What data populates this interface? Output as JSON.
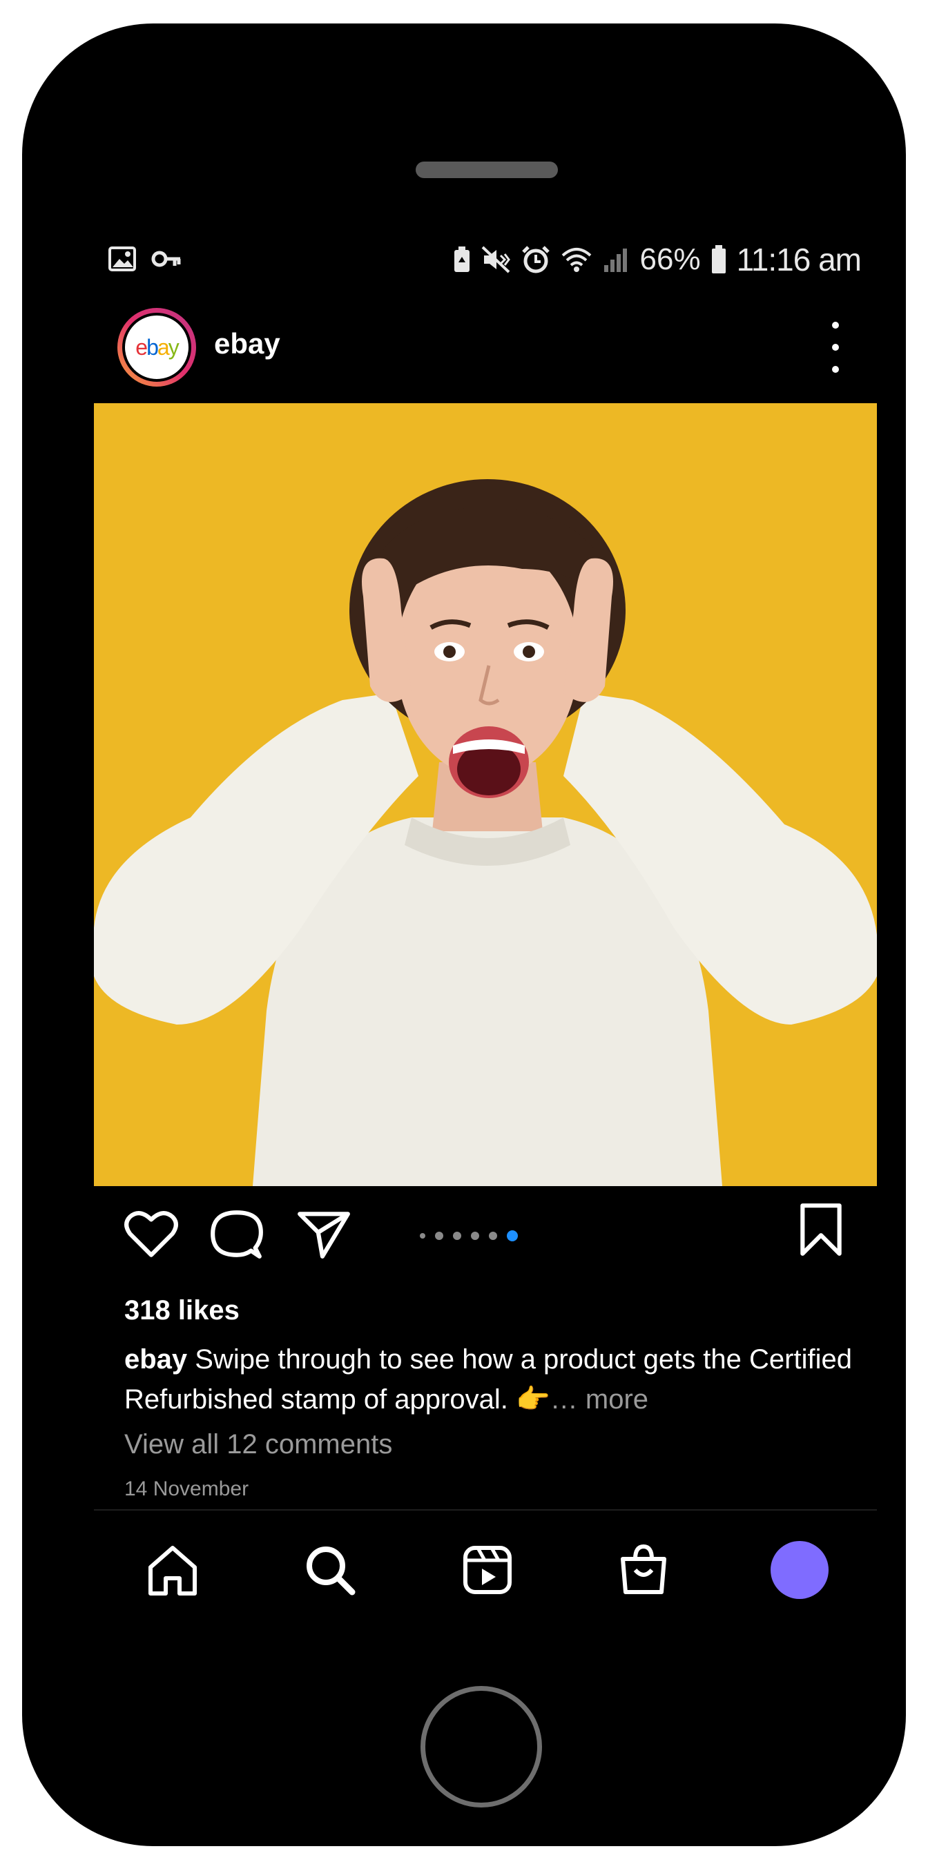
{
  "status_bar": {
    "left_icons": [
      "image-icon",
      "key-icon"
    ],
    "right_icons": [
      "battery-saver-icon",
      "mute-icon",
      "alarm-icon",
      "wifi-icon",
      "signal-icon"
    ],
    "battery": "66%",
    "time": "11:16 am"
  },
  "post": {
    "username": "ebay",
    "avatar_logo": {
      "e": "e",
      "b": "b",
      "a": "a",
      "y": "y"
    },
    "image_icon": "surprised-woman-photo",
    "carousel": {
      "count": 6,
      "active_index": 5
    },
    "likes": "318 likes",
    "caption_user": "ebay",
    "caption_text": " Swipe through to see how a product gets the Certified Refurbished stamp of approval. ",
    "caption_emoji": "👉",
    "caption_more": "… more",
    "comments_link": "View all 12 comments",
    "date": "14 November"
  },
  "actions": [
    "heart-icon",
    "comment-icon",
    "share-icon",
    "bookmark-icon"
  ],
  "nav": [
    "home-icon",
    "search-icon",
    "reels-icon",
    "shop-icon",
    "profile-avatar"
  ],
  "colors": {
    "image_bg": "#edb825",
    "accent_blue": "#1e90ff",
    "profile": "#7f6cff"
  }
}
